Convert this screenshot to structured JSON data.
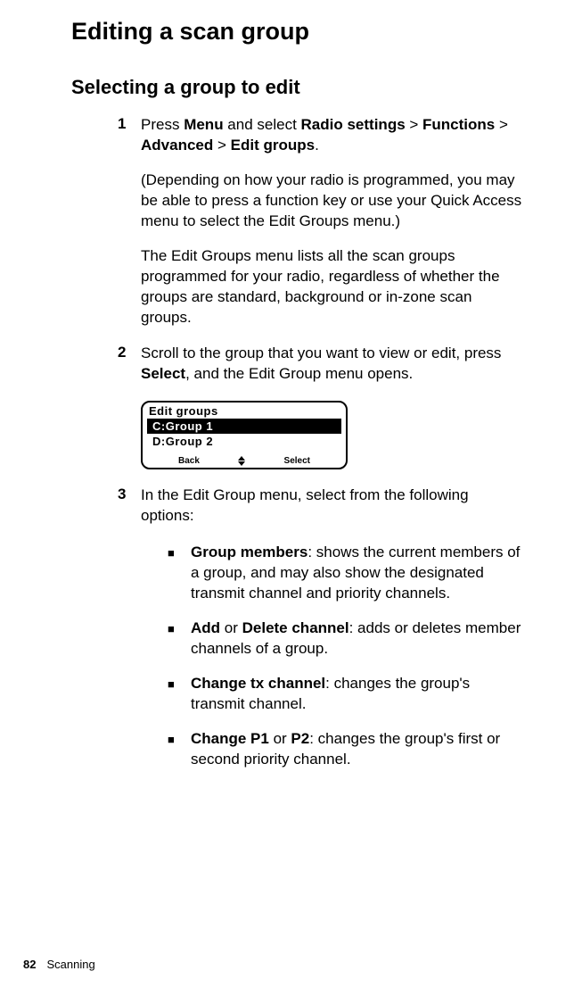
{
  "heading1": "Editing a scan group",
  "heading2": "Selecting a group to edit",
  "steps": [
    {
      "num": "1",
      "para1_pre": "Press ",
      "para1_b1": "Menu",
      "para1_mid1": " and select ",
      "para1_b2": "Radio settings",
      "para1_mid2": " > ",
      "para1_b3": "Functions",
      "para1_mid3": " > ",
      "para1_b4": "Advanced",
      "para1_mid4": " > ",
      "para1_b5": "Edit groups",
      "para1_suf": ".",
      "para2": "(Depending on how your radio is programmed, you may be able to press a function key or use your Quick Access menu to select the Edit Groups menu.)",
      "para3": "The Edit Groups menu lists all the scan groups programmed for your radio, regardless of whether the groups are standard, background or in-zone scan groups."
    },
    {
      "num": "2",
      "para1_pre": "Scroll to the group that you want to view or edit, press ",
      "para1_b1": "Select",
      "para1_suf": ", and the Edit Group menu opens."
    },
    {
      "num": "3",
      "para1": "In the Edit Group menu, select from the following options:"
    }
  ],
  "display": {
    "title": "Edit groups",
    "line_sel": "C:Group 1",
    "line2": "D:Group 2",
    "sk_left": "Back",
    "sk_right": "Select"
  },
  "bullets": [
    {
      "b1": "Group members",
      "rest": ": shows the current members of a group, and may also show the designated transmit channel and priority channels."
    },
    {
      "b1": "Add",
      "mid1": " or ",
      "b2": "Delete channel",
      "rest": ": adds or deletes member channels of a group."
    },
    {
      "b1": "Change tx channel",
      "rest": ": changes the group's transmit channel."
    },
    {
      "b1": "Change P1",
      "mid1": " or ",
      "b2": "P2",
      "rest": ": changes the group's first or second priority channel."
    }
  ],
  "footer": {
    "page": "82",
    "section": "Scanning"
  }
}
